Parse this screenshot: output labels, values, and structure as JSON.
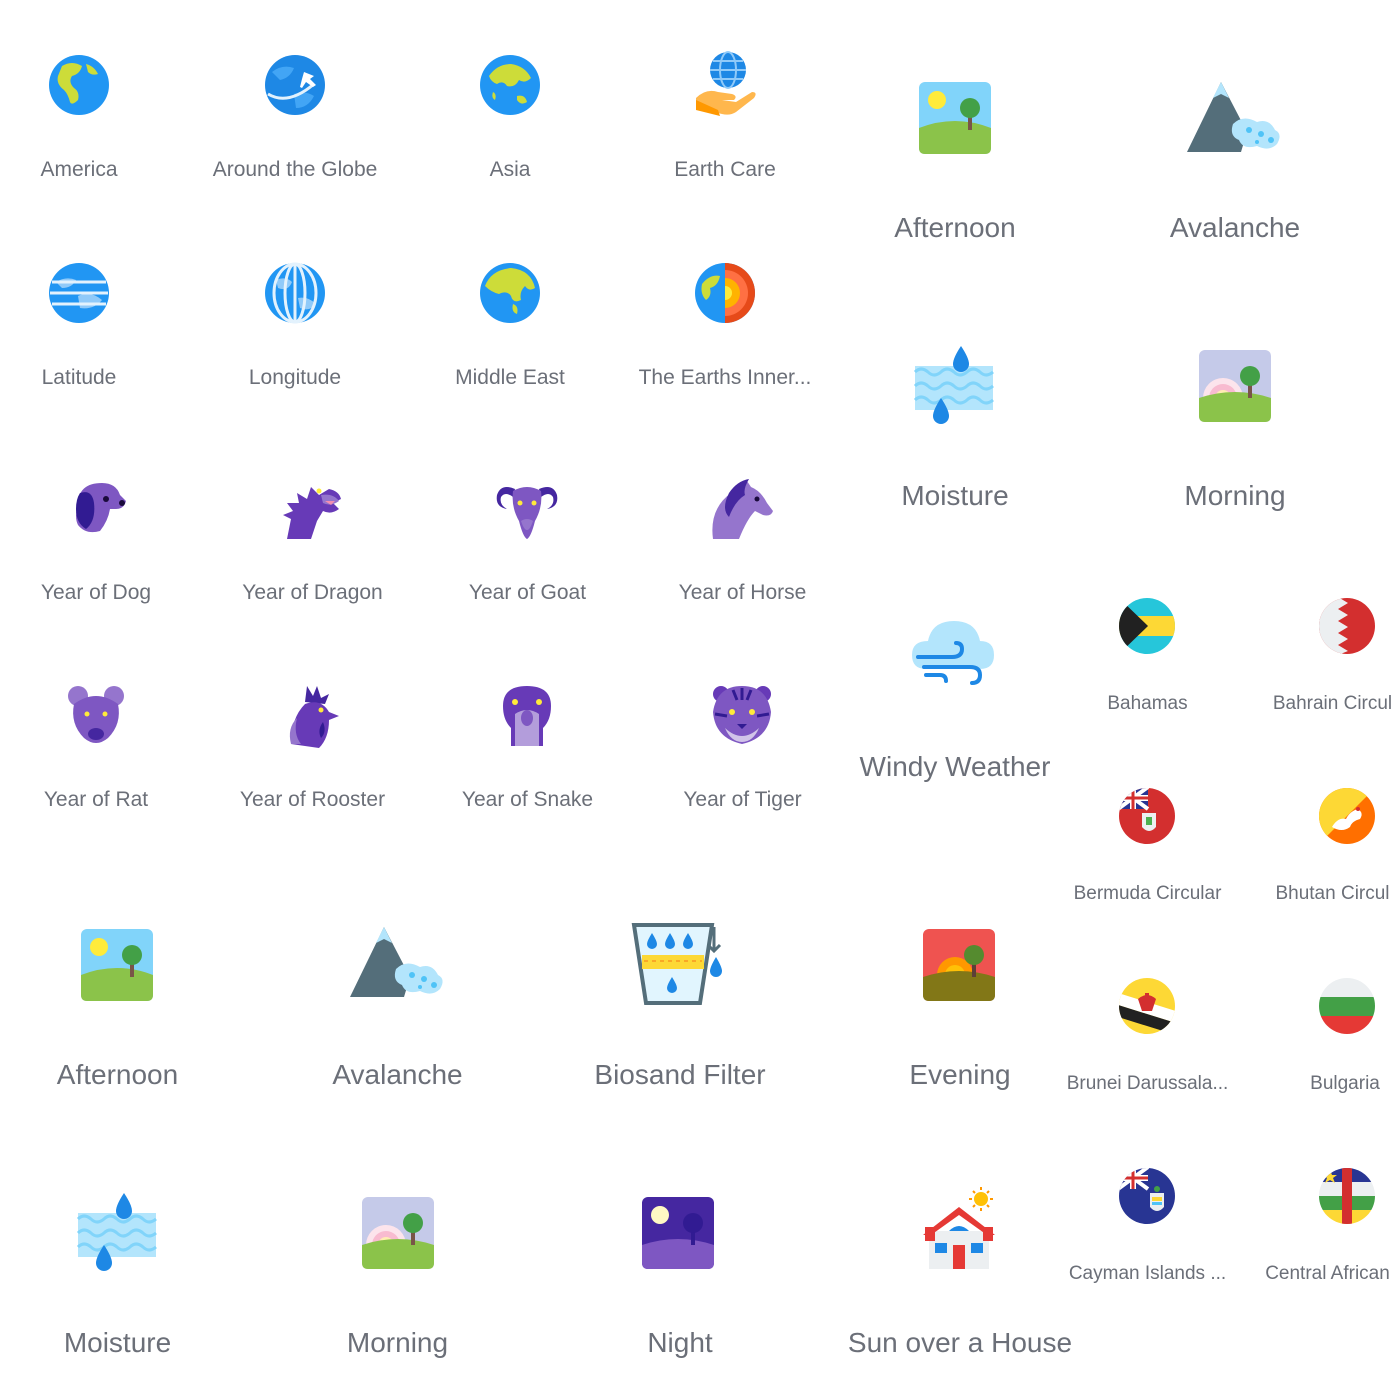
{
  "groups": {
    "earth": [
      "America",
      "Around the Globe",
      "Asia",
      "Earth Care",
      "Latitude",
      "Longitude",
      "Middle East",
      "The Earths Inner..."
    ],
    "zodiac": [
      "Year of Dog",
      "Year of Dragon",
      "Year of Goat",
      "Year of Horse",
      "Year of Rat",
      "Year of Rooster",
      "Year of Snake",
      "Year of Tiger"
    ],
    "weather_small": [
      "Afternoon",
      "Avalanche",
      "Moisture",
      "Morning",
      "Windy Weather"
    ],
    "flags": [
      "Bahamas",
      "Bahrain Circul",
      "Bermuda Circular",
      "Bhutan Circul",
      "Brunei Darussala...",
      "Bulgaria",
      "Cayman Islands ...",
      "Central African"
    ],
    "weather_large": [
      "Afternoon",
      "Avalanche",
      "Biosand Filter",
      "Evening",
      "Moisture",
      "Morning",
      "Night",
      "Sun over a House"
    ]
  },
  "colors": {
    "label": "#6b6f78",
    "earth_blue": "#2196f3",
    "earth_green": "#cddc39",
    "zodiac_purple": "#673ab7",
    "zodiac_light": "#9575cd"
  },
  "icons": {
    "earth": [
      "america-globe-icon",
      "around-globe-plane-icon",
      "asia-globe-icon",
      "earth-care-hand-icon",
      "latitude-globe-icon",
      "longitude-globe-icon",
      "middle-east-globe-icon",
      "earth-inner-core-icon"
    ],
    "zodiac": [
      "dog-icon",
      "dragon-icon",
      "goat-icon",
      "horse-icon",
      "rat-icon",
      "rooster-icon",
      "snake-icon",
      "tiger-icon"
    ],
    "weather": [
      "afternoon-landscape-icon",
      "avalanche-mountain-icon",
      "moisture-water-icon",
      "morning-landscape-icon",
      "windy-cloud-icon",
      "biosand-filter-icon",
      "evening-landscape-icon",
      "night-landscape-icon",
      "sun-over-house-icon"
    ],
    "flags": [
      "bahamas-flag-icon",
      "bahrain-flag-icon",
      "bermuda-flag-icon",
      "bhutan-flag-icon",
      "brunei-flag-icon",
      "bulgaria-flag-icon",
      "cayman-islands-flag-icon",
      "central-african-flag-icon"
    ]
  }
}
